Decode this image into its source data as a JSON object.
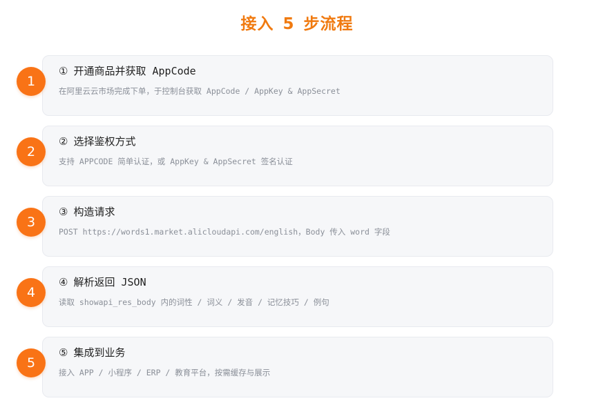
{
  "page": {
    "title": "接入 5 步流程"
  },
  "steps": [
    {
      "badge": "1",
      "number": "①",
      "title": "开通商品并获取 AppCode",
      "description": "在阿里云云市场完成下单，于控制台获取 AppCode / AppKey & AppSecret"
    },
    {
      "badge": "2",
      "number": "②",
      "title": "选择鉴权方式",
      "description": "支持 APPCODE 简单认证，或 AppKey & AppSecret 签名认证"
    },
    {
      "badge": "3",
      "number": "③",
      "title": "构造请求",
      "description": "POST https://words1.market.alicloudapi.com/english，Body 传入 word 字段"
    },
    {
      "badge": "4",
      "number": "④",
      "title": "解析返回 JSON",
      "description": "读取 showapi_res_body 内的词性 / 词义 / 发音 / 记忆技巧 / 例句"
    },
    {
      "badge": "5",
      "number": "⑤",
      "title": "集成到业务",
      "description": "接入 APP / 小程序 / ERP / 教育平台，按需缓存与展示"
    }
  ],
  "colors": {
    "accent": "#f97316",
    "title": "#f07a10",
    "card_bg": "#f6f7f9",
    "card_border": "#e8eaef",
    "desc_text": "#8a8f98"
  }
}
